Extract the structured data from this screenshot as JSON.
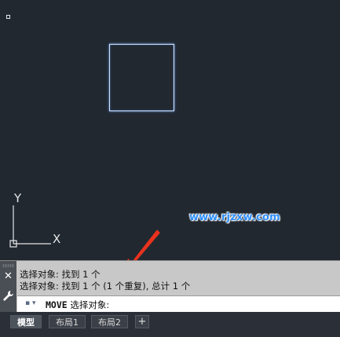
{
  "watermark": "www.rjzxw.com",
  "ucs": {
    "y_label": "Y",
    "x_label": "X"
  },
  "command_line": {
    "history": [
      "选择对象: 找到 1 个",
      "选择对象: 找到 1 个 (1 个重复), 总计 1 个"
    ],
    "command": "MOVE",
    "prompt": "选择对象:"
  },
  "tabs": [
    "模型",
    "布局1",
    "布局2"
  ],
  "add_tab": "+",
  "colors": {
    "canvas": "#212830",
    "object_highlight": "#cfe4ff",
    "arrow": "#e8321e",
    "watermark": "#2e8fff"
  }
}
